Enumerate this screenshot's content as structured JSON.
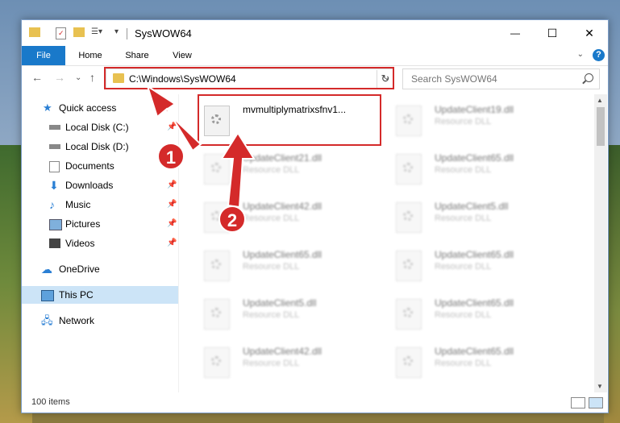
{
  "window": {
    "title": "SysWOW64",
    "minimize": "—",
    "maximize": "☐",
    "close": "✕"
  },
  "ribbon": {
    "tabs": [
      "File",
      "Home",
      "Share",
      "View"
    ],
    "help": "?"
  },
  "address": {
    "path": "C:\\Windows\\SysWOW64"
  },
  "search": {
    "placeholder": "Search SysWOW64"
  },
  "nav": {
    "items": [
      {
        "label": "Quick access",
        "icon": "star-icon",
        "pinned": false
      },
      {
        "label": "Local Disk (C:)",
        "icon": "drive-icon",
        "pinned": true
      },
      {
        "label": "Local Disk (D:)",
        "icon": "drive-icon",
        "pinned": false
      },
      {
        "label": "Documents",
        "icon": "documents-icon",
        "pinned": true
      },
      {
        "label": "Downloads",
        "icon": "download-icon",
        "pinned": true
      },
      {
        "label": "Music",
        "icon": "music-icon",
        "pinned": true
      },
      {
        "label": "Pictures",
        "icon": "pictures-icon",
        "pinned": true
      },
      {
        "label": "Videos",
        "icon": "videos-icon",
        "pinned": true
      },
      {
        "label": "OneDrive",
        "icon": "cloud-icon",
        "pinned": false
      },
      {
        "label": "This PC",
        "icon": "computer-icon",
        "pinned": false
      },
      {
        "label": "Network",
        "icon": "network-icon",
        "pinned": false
      }
    ]
  },
  "files": [
    {
      "name": "mvmultiplymatrixsfnv1...",
      "type": "",
      "blurred": false
    },
    {
      "name": "UpdateClient19.dll",
      "type": "Resource DLL",
      "blurred": true
    },
    {
      "name": "UpdateClient21.dll",
      "type": "Resource DLL",
      "blurred": true
    },
    {
      "name": "UpdateClient65.dll",
      "type": "Resource DLL",
      "blurred": true
    },
    {
      "name": "UpdateClient42.dll",
      "type": "Resource DLL",
      "blurred": true
    },
    {
      "name": "UpdateClient5.dll",
      "type": "Resource DLL",
      "blurred": true
    },
    {
      "name": "UpdateClient65.dll",
      "type": "Resource DLL",
      "blurred": true
    },
    {
      "name": "UpdateClient65.dll",
      "type": "Resource DLL",
      "blurred": true
    },
    {
      "name": "UpdateClient5.dll",
      "type": "Resource DLL",
      "blurred": true
    },
    {
      "name": "UpdateClient65.dll",
      "type": "Resource DLL",
      "blurred": true
    },
    {
      "name": "UpdateClient42.dll",
      "type": "Resource DLL",
      "blurred": true
    },
    {
      "name": "UpdateClient65.dll",
      "type": "Resource DLL",
      "blurred": true
    }
  ],
  "status": {
    "item_count": "100 items"
  },
  "annotations": {
    "callout_1": "1",
    "callout_2": "2"
  },
  "colors": {
    "accent": "#1979ca",
    "highlight": "#d42a2a",
    "selected_nav": "#cce4f7"
  }
}
